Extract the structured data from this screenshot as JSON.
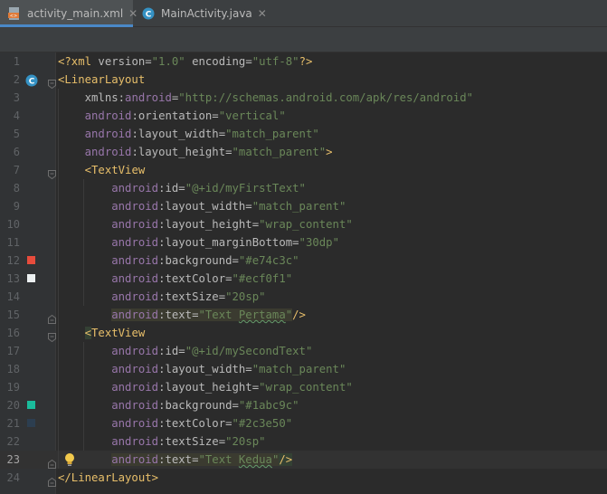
{
  "tabs": [
    {
      "label": "activity_main.xml",
      "icon": "xml-file-icon",
      "active": true
    },
    {
      "label": "MainActivity.java",
      "icon": "java-class-icon",
      "active": false
    }
  ],
  "editor": {
    "current_line": 23,
    "lines": [
      {
        "n": "1",
        "segs": [
          [
            "t-tag",
            "<?xml "
          ],
          [
            "t-attr",
            "version="
          ],
          [
            "t-val",
            "\"1.0\""
          ],
          [
            "t-plain",
            " "
          ],
          [
            "t-attr",
            "encoding="
          ],
          [
            "t-val",
            "\"utf-8\""
          ],
          [
            "t-tag",
            "?>"
          ]
        ]
      },
      {
        "n": "2",
        "segs": [
          [
            "t-tag",
            "<LinearLayout"
          ]
        ]
      },
      {
        "n": "3",
        "segs": [
          [
            "t-plain",
            "    "
          ],
          [
            "t-attr",
            "xmlns:"
          ],
          [
            "t-ns",
            "android"
          ],
          [
            "t-attr",
            "="
          ],
          [
            "t-val",
            "\"http://schemas.android.com/apk/res/android\""
          ]
        ]
      },
      {
        "n": "4",
        "segs": [
          [
            "t-plain",
            "    "
          ],
          [
            "t-ns",
            "android"
          ],
          [
            "t-attr",
            ":orientation="
          ],
          [
            "t-val",
            "\"vertical\""
          ]
        ]
      },
      {
        "n": "5",
        "segs": [
          [
            "t-plain",
            "    "
          ],
          [
            "t-ns",
            "android"
          ],
          [
            "t-attr",
            ":layout_width="
          ],
          [
            "t-val",
            "\"match_parent\""
          ]
        ]
      },
      {
        "n": "6",
        "segs": [
          [
            "t-plain",
            "    "
          ],
          [
            "t-ns",
            "android"
          ],
          [
            "t-attr",
            ":layout_height="
          ],
          [
            "t-val",
            "\"match_parent\""
          ],
          [
            "t-tag",
            ">"
          ]
        ]
      },
      {
        "n": "7",
        "segs": [
          [
            "t-plain",
            "    "
          ],
          [
            "t-tag",
            "<TextView"
          ]
        ]
      },
      {
        "n": "8",
        "segs": [
          [
            "t-plain",
            "        "
          ],
          [
            "t-ns",
            "android"
          ],
          [
            "t-attr",
            ":id="
          ],
          [
            "t-val",
            "\"@+id/myFirstText\""
          ]
        ]
      },
      {
        "n": "9",
        "segs": [
          [
            "t-plain",
            "        "
          ],
          [
            "t-ns",
            "android"
          ],
          [
            "t-attr",
            ":layout_width="
          ],
          [
            "t-val",
            "\"match_parent\""
          ]
        ]
      },
      {
        "n": "10",
        "segs": [
          [
            "t-plain",
            "        "
          ],
          [
            "t-ns",
            "android"
          ],
          [
            "t-attr",
            ":layout_height="
          ],
          [
            "t-val",
            "\"wrap_content\""
          ]
        ]
      },
      {
        "n": "11",
        "segs": [
          [
            "t-plain",
            "        "
          ],
          [
            "t-ns",
            "android"
          ],
          [
            "t-attr",
            ":layout_marginBottom="
          ],
          [
            "t-val",
            "\"30dp\""
          ]
        ]
      },
      {
        "n": "12",
        "segs": [
          [
            "t-plain",
            "        "
          ],
          [
            "t-ns",
            "android"
          ],
          [
            "t-attr",
            ":background="
          ],
          [
            "t-val",
            "\"#e74c3c\""
          ]
        ]
      },
      {
        "n": "13",
        "segs": [
          [
            "t-plain",
            "        "
          ],
          [
            "t-ns",
            "android"
          ],
          [
            "t-attr",
            ":textColor="
          ],
          [
            "t-val",
            "\"#ecf0f1\""
          ]
        ]
      },
      {
        "n": "14",
        "segs": [
          [
            "t-plain",
            "        "
          ],
          [
            "t-ns",
            "android"
          ],
          [
            "t-attr",
            ":textSize="
          ],
          [
            "t-val",
            "\"20sp\""
          ]
        ]
      },
      {
        "n": "15",
        "segs": [
          [
            "t-plain",
            "        "
          ],
          [
            "t-ns hl",
            "android"
          ],
          [
            "t-attr hl",
            ":text="
          ],
          [
            "t-val hl",
            "\"Text "
          ],
          [
            "t-val hl typo",
            "Pertama"
          ],
          [
            "t-val hl",
            "\""
          ],
          [
            "t-tag",
            "/>"
          ]
        ]
      },
      {
        "n": "16",
        "segs": [
          [
            "t-plain",
            "    "
          ],
          [
            "t-tag tagmatch",
            "<"
          ],
          [
            "t-tag",
            "TextView"
          ]
        ]
      },
      {
        "n": "17",
        "segs": [
          [
            "t-plain",
            "        "
          ],
          [
            "t-ns",
            "android"
          ],
          [
            "t-attr",
            ":id="
          ],
          [
            "t-val",
            "\"@+id/mySecondText\""
          ]
        ]
      },
      {
        "n": "18",
        "segs": [
          [
            "t-plain",
            "        "
          ],
          [
            "t-ns",
            "android"
          ],
          [
            "t-attr",
            ":layout_width="
          ],
          [
            "t-val",
            "\"match_parent\""
          ]
        ]
      },
      {
        "n": "19",
        "segs": [
          [
            "t-plain",
            "        "
          ],
          [
            "t-ns",
            "android"
          ],
          [
            "t-attr",
            ":layout_height="
          ],
          [
            "t-val",
            "\"wrap_content\""
          ]
        ]
      },
      {
        "n": "20",
        "segs": [
          [
            "t-plain",
            "        "
          ],
          [
            "t-ns",
            "android"
          ],
          [
            "t-attr",
            ":background="
          ],
          [
            "t-val",
            "\"#1abc9c\""
          ]
        ]
      },
      {
        "n": "21",
        "segs": [
          [
            "t-plain",
            "        "
          ],
          [
            "t-ns",
            "android"
          ],
          [
            "t-attr",
            ":textColor="
          ],
          [
            "t-val",
            "\"#2c3e50\""
          ]
        ]
      },
      {
        "n": "22",
        "segs": [
          [
            "t-plain",
            "        "
          ],
          [
            "t-ns",
            "android"
          ],
          [
            "t-attr",
            ":textSize="
          ],
          [
            "t-val",
            "\"20sp\""
          ]
        ]
      },
      {
        "n": "23",
        "segs": [
          [
            "t-plain",
            "        "
          ],
          [
            "t-ns hl",
            "android"
          ],
          [
            "t-attr hl",
            ":text="
          ],
          [
            "t-val hl",
            "\"Text "
          ],
          [
            "t-val hl typo",
            "Kedua"
          ],
          [
            "t-val hl",
            "\""
          ],
          [
            "t-tag tagmatch",
            "/>"
          ]
        ]
      },
      {
        "n": "24",
        "segs": [
          [
            "t-tag",
            "</LinearLayout>"
          ]
        ]
      }
    ]
  },
  "gutter_markers": [
    {
      "line": 2,
      "icon": "class-c-icon",
      "color": "#3592c4"
    },
    {
      "line": 12,
      "icon": "color-swatch-icon",
      "color": "#e74c3c"
    },
    {
      "line": 13,
      "icon": "color-swatch-icon",
      "color": "#ecf0f1"
    },
    {
      "line": 20,
      "icon": "color-swatch-icon",
      "color": "#1abc9c"
    },
    {
      "line": 21,
      "icon": "color-swatch-icon",
      "color": "#2c3e50"
    },
    {
      "line": 23,
      "icon": "lightbulb-icon",
      "color": "#f2c94c"
    }
  ],
  "fold_markers": [
    {
      "line": 2,
      "icon": "fold-open-icon"
    },
    {
      "line": 7,
      "icon": "fold-open-icon"
    },
    {
      "line": 15,
      "icon": "fold-close-icon"
    },
    {
      "line": 16,
      "icon": "fold-open-icon"
    },
    {
      "line": 23,
      "icon": "fold-close-icon"
    },
    {
      "line": 24,
      "icon": "fold-close-icon"
    }
  ]
}
